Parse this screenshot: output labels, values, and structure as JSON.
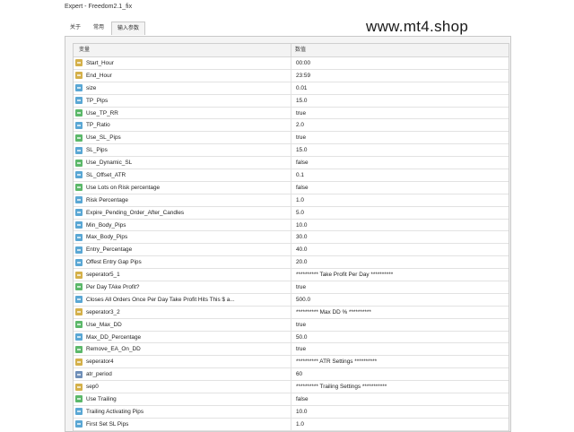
{
  "window": {
    "title": "Expert - Freedom2.1_fix"
  },
  "watermark": "www.mt4.shop",
  "tabs": [
    {
      "label": "关于",
      "active": false
    },
    {
      "label": "常用",
      "active": false
    },
    {
      "label": "输入参数",
      "active": true
    }
  ],
  "table": {
    "headers": {
      "variable": "变量",
      "value": "数值"
    },
    "rows": [
      {
        "icon": "ab-string-icon",
        "type": "ab",
        "name": "Start_Hour",
        "value": "00:00"
      },
      {
        "icon": "ab-string-icon",
        "type": "ab",
        "name": "End_Hour",
        "value": "23:59"
      },
      {
        "icon": "number-icon",
        "type": "num",
        "name": "size",
        "value": "0.01"
      },
      {
        "icon": "number-icon",
        "type": "num",
        "name": "TP_Pips",
        "value": "15.0"
      },
      {
        "icon": "bool-icon",
        "type": "bool",
        "name": "Use_TP_RR",
        "value": "true"
      },
      {
        "icon": "number-icon",
        "type": "num",
        "name": "TP_Ratio",
        "value": "2.0"
      },
      {
        "icon": "bool-icon",
        "type": "bool",
        "name": "Use_SL_Pips",
        "value": "true"
      },
      {
        "icon": "number-icon",
        "type": "num",
        "name": "SL_Pips",
        "value": "15.0"
      },
      {
        "icon": "bool-icon",
        "type": "bool",
        "name": "Use_Dynamic_SL",
        "value": "false"
      },
      {
        "icon": "number-icon",
        "type": "num",
        "name": "SL_Offset_ATR",
        "value": "0.1"
      },
      {
        "icon": "bool-icon",
        "type": "bool",
        "name": "Use Lots on Risk percentage",
        "value": "false"
      },
      {
        "icon": "number-icon",
        "type": "num",
        "name": "Risk Percentage",
        "value": "1.0"
      },
      {
        "icon": "number-icon",
        "type": "num",
        "name": "Expire_Pending_Order_After_Candles",
        "value": "5.0"
      },
      {
        "icon": "number-icon",
        "type": "num",
        "name": "Min_Body_Pips",
        "value": "10.0"
      },
      {
        "icon": "number-icon",
        "type": "num",
        "name": "Max_Body_Pips",
        "value": "30.0"
      },
      {
        "icon": "number-icon",
        "type": "num",
        "name": "Entry_Percentage",
        "value": "40.0"
      },
      {
        "icon": "number-icon",
        "type": "num",
        "name": "Offest Entry Gap Pips",
        "value": "20.0"
      },
      {
        "icon": "ab-string-icon",
        "type": "ab",
        "name": "seperator5_1",
        "value": "**********   Take Profit Per Day   **********"
      },
      {
        "icon": "bool-icon",
        "type": "bool",
        "name": "Per Day TAke Profit?",
        "value": "true"
      },
      {
        "icon": "number-icon",
        "type": "num",
        "name": "Closes All Orders Once Per Day Take Profit Hits This $ a...",
        "value": "500.0"
      },
      {
        "icon": "ab-string-icon",
        "type": "ab",
        "name": "seperator3_2",
        "value": "**********   Max DD %   **********"
      },
      {
        "icon": "bool-icon",
        "type": "bool",
        "name": "Use_Max_DD",
        "value": "true"
      },
      {
        "icon": "number-icon",
        "type": "num",
        "name": "Max_DD_Percentage",
        "value": "50.0"
      },
      {
        "icon": "bool-icon",
        "type": "bool",
        "name": "Remove_EA_On_DD",
        "value": "true"
      },
      {
        "icon": "ab-string-icon",
        "type": "ab",
        "name": "seperator4",
        "value": "**********   ATR Settings   **********"
      },
      {
        "icon": "text-int-icon",
        "type": "txt",
        "name": "atr_period",
        "value": "60"
      },
      {
        "icon": "ab-string-icon",
        "type": "ab",
        "name": "sep0",
        "value": "********** Trailing Settings ***********"
      },
      {
        "icon": "bool-icon",
        "type": "bool",
        "name": "Use Trailing",
        "value": "false"
      },
      {
        "icon": "number-icon",
        "type": "num",
        "name": "Trailing Activating Pips",
        "value": "10.0"
      },
      {
        "icon": "number-icon",
        "type": "num",
        "name": "First Set SL  Pips",
        "value": "1.0"
      }
    ]
  }
}
